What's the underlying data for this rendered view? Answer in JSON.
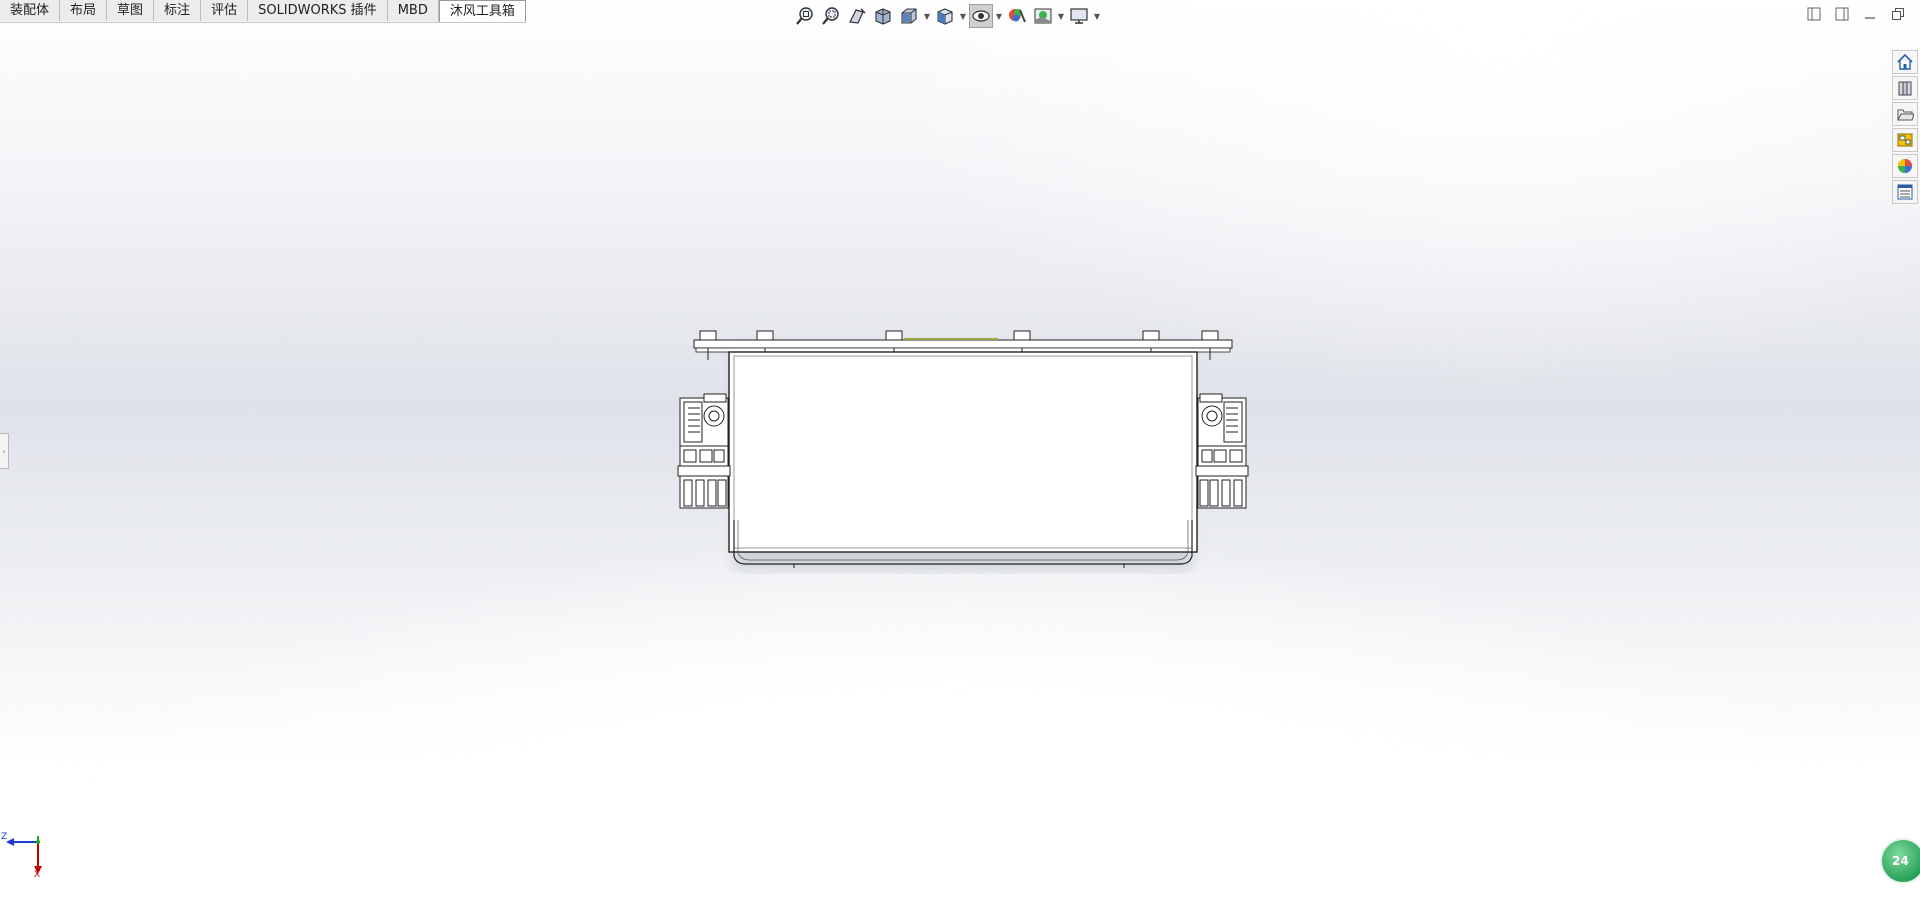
{
  "tabs": [
    {
      "label": "装配体",
      "active": false
    },
    {
      "label": "布局",
      "active": false
    },
    {
      "label": "草图",
      "active": false
    },
    {
      "label": "标注",
      "active": false
    },
    {
      "label": "评估",
      "active": false
    },
    {
      "label": "SOLIDWORKS 插件",
      "active": false
    },
    {
      "label": "MBD",
      "active": false
    },
    {
      "label": "沐风工具箱",
      "active": true
    }
  ],
  "hud_icons": [
    "zoom-to-fit-icon",
    "zoom-to-area-icon",
    "previous-view-icon",
    "section-view-icon",
    "view-orientation-icon",
    "display-style-icon",
    "hide-show-items-icon",
    "edit-appearance-icon",
    "apply-scene-icon",
    "view-settings-icon"
  ],
  "window_controls": [
    "tile-left-icon",
    "tile-right-icon",
    "minimize-icon",
    "restore-icon"
  ],
  "task_pane": [
    "home-icon",
    "design-library-icon",
    "file-explorer-icon",
    "view-palette-icon",
    "appearances-icon",
    "custom-properties-icon"
  ],
  "triad": {
    "z_label": "Z",
    "x_label": "X"
  },
  "badge": {
    "text": "24"
  },
  "colors": {
    "accent_green": "#2aa058",
    "triad_red": "#c00000",
    "triad_blue": "#1a3bd6",
    "triad_green": "#1ea51e"
  }
}
